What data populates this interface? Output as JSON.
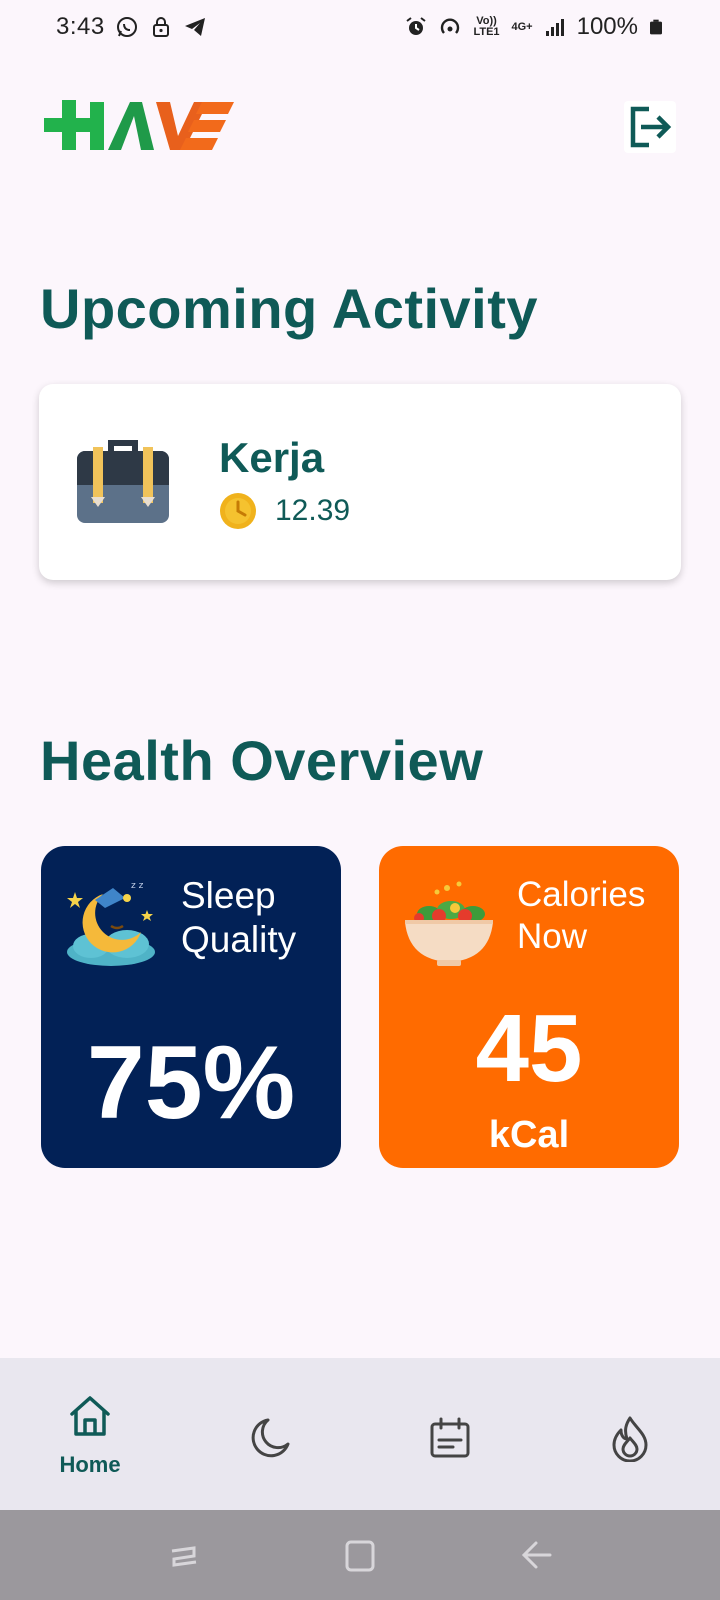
{
  "status_bar": {
    "time": "3:43",
    "battery": "100%",
    "network_label_top": "Vo)) LTE1",
    "network_label_4g": "4G+"
  },
  "header": {
    "logo_text": "HAVE",
    "logout_icon": "logout-icon"
  },
  "upcoming": {
    "title": "Upcoming Activity",
    "activity": {
      "name": "Kerja",
      "time": "12.39",
      "icon": "briefcase-icon"
    }
  },
  "health": {
    "title": "Health Overview",
    "sleep": {
      "label_line1": "Sleep",
      "label_line2": "Quality",
      "value": "75%",
      "icon": "sleeping-moon-icon"
    },
    "calories": {
      "label_line1": "Calories",
      "label_line2": "Now",
      "value": "45",
      "unit": "kCal",
      "icon": "salad-bowl-icon"
    }
  },
  "nav": {
    "items": [
      {
        "label": "Home",
        "icon": "home-icon",
        "active": true
      },
      {
        "label": "",
        "icon": "moon-icon",
        "active": false
      },
      {
        "label": "",
        "icon": "calendar-icon",
        "active": false
      },
      {
        "label": "",
        "icon": "flame-icon",
        "active": false
      }
    ]
  },
  "colors": {
    "primary": "#0f5a57",
    "background": "#fcf6fc",
    "sleep_card": "#022156",
    "calories_card": "#ff6b00",
    "nav_bg": "#e9e7ef",
    "logo_green": "#22b24c",
    "logo_orange": "#f26a1b"
  }
}
